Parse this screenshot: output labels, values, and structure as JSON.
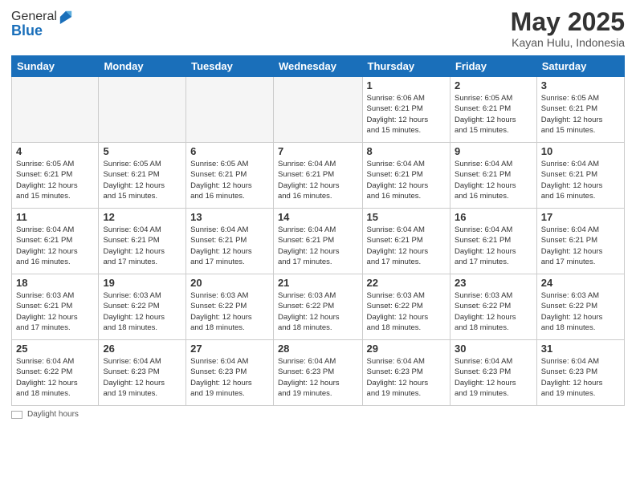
{
  "header": {
    "logo_general": "General",
    "logo_blue": "Blue",
    "main_title": "May 2025",
    "subtitle": "Kayan Hulu, Indonesia"
  },
  "days_of_week": [
    "Sunday",
    "Monday",
    "Tuesday",
    "Wednesday",
    "Thursday",
    "Friday",
    "Saturday"
  ],
  "weeks": [
    [
      {
        "day": "",
        "info": ""
      },
      {
        "day": "",
        "info": ""
      },
      {
        "day": "",
        "info": ""
      },
      {
        "day": "",
        "info": ""
      },
      {
        "day": "1",
        "info": "Sunrise: 6:06 AM\nSunset: 6:21 PM\nDaylight: 12 hours\nand 15 minutes."
      },
      {
        "day": "2",
        "info": "Sunrise: 6:05 AM\nSunset: 6:21 PM\nDaylight: 12 hours\nand 15 minutes."
      },
      {
        "day": "3",
        "info": "Sunrise: 6:05 AM\nSunset: 6:21 PM\nDaylight: 12 hours\nand 15 minutes."
      }
    ],
    [
      {
        "day": "4",
        "info": "Sunrise: 6:05 AM\nSunset: 6:21 PM\nDaylight: 12 hours\nand 15 minutes."
      },
      {
        "day": "5",
        "info": "Sunrise: 6:05 AM\nSunset: 6:21 PM\nDaylight: 12 hours\nand 15 minutes."
      },
      {
        "day": "6",
        "info": "Sunrise: 6:05 AM\nSunset: 6:21 PM\nDaylight: 12 hours\nand 16 minutes."
      },
      {
        "day": "7",
        "info": "Sunrise: 6:04 AM\nSunset: 6:21 PM\nDaylight: 12 hours\nand 16 minutes."
      },
      {
        "day": "8",
        "info": "Sunrise: 6:04 AM\nSunset: 6:21 PM\nDaylight: 12 hours\nand 16 minutes."
      },
      {
        "day": "9",
        "info": "Sunrise: 6:04 AM\nSunset: 6:21 PM\nDaylight: 12 hours\nand 16 minutes."
      },
      {
        "day": "10",
        "info": "Sunrise: 6:04 AM\nSunset: 6:21 PM\nDaylight: 12 hours\nand 16 minutes."
      }
    ],
    [
      {
        "day": "11",
        "info": "Sunrise: 6:04 AM\nSunset: 6:21 PM\nDaylight: 12 hours\nand 16 minutes."
      },
      {
        "day": "12",
        "info": "Sunrise: 6:04 AM\nSunset: 6:21 PM\nDaylight: 12 hours\nand 17 minutes."
      },
      {
        "day": "13",
        "info": "Sunrise: 6:04 AM\nSunset: 6:21 PM\nDaylight: 12 hours\nand 17 minutes."
      },
      {
        "day": "14",
        "info": "Sunrise: 6:04 AM\nSunset: 6:21 PM\nDaylight: 12 hours\nand 17 minutes."
      },
      {
        "day": "15",
        "info": "Sunrise: 6:04 AM\nSunset: 6:21 PM\nDaylight: 12 hours\nand 17 minutes."
      },
      {
        "day": "16",
        "info": "Sunrise: 6:04 AM\nSunset: 6:21 PM\nDaylight: 12 hours\nand 17 minutes."
      },
      {
        "day": "17",
        "info": "Sunrise: 6:04 AM\nSunset: 6:21 PM\nDaylight: 12 hours\nand 17 minutes."
      }
    ],
    [
      {
        "day": "18",
        "info": "Sunrise: 6:03 AM\nSunset: 6:21 PM\nDaylight: 12 hours\nand 17 minutes."
      },
      {
        "day": "19",
        "info": "Sunrise: 6:03 AM\nSunset: 6:22 PM\nDaylight: 12 hours\nand 18 minutes."
      },
      {
        "day": "20",
        "info": "Sunrise: 6:03 AM\nSunset: 6:22 PM\nDaylight: 12 hours\nand 18 minutes."
      },
      {
        "day": "21",
        "info": "Sunrise: 6:03 AM\nSunset: 6:22 PM\nDaylight: 12 hours\nand 18 minutes."
      },
      {
        "day": "22",
        "info": "Sunrise: 6:03 AM\nSunset: 6:22 PM\nDaylight: 12 hours\nand 18 minutes."
      },
      {
        "day": "23",
        "info": "Sunrise: 6:03 AM\nSunset: 6:22 PM\nDaylight: 12 hours\nand 18 minutes."
      },
      {
        "day": "24",
        "info": "Sunrise: 6:03 AM\nSunset: 6:22 PM\nDaylight: 12 hours\nand 18 minutes."
      }
    ],
    [
      {
        "day": "25",
        "info": "Sunrise: 6:04 AM\nSunset: 6:22 PM\nDaylight: 12 hours\nand 18 minutes."
      },
      {
        "day": "26",
        "info": "Sunrise: 6:04 AM\nSunset: 6:23 PM\nDaylight: 12 hours\nand 19 minutes."
      },
      {
        "day": "27",
        "info": "Sunrise: 6:04 AM\nSunset: 6:23 PM\nDaylight: 12 hours\nand 19 minutes."
      },
      {
        "day": "28",
        "info": "Sunrise: 6:04 AM\nSunset: 6:23 PM\nDaylight: 12 hours\nand 19 minutes."
      },
      {
        "day": "29",
        "info": "Sunrise: 6:04 AM\nSunset: 6:23 PM\nDaylight: 12 hours\nand 19 minutes."
      },
      {
        "day": "30",
        "info": "Sunrise: 6:04 AM\nSunset: 6:23 PM\nDaylight: 12 hours\nand 19 minutes."
      },
      {
        "day": "31",
        "info": "Sunrise: 6:04 AM\nSunset: 6:23 PM\nDaylight: 12 hours\nand 19 minutes."
      }
    ]
  ],
  "footer": {
    "legend_label": "Daylight hours"
  }
}
